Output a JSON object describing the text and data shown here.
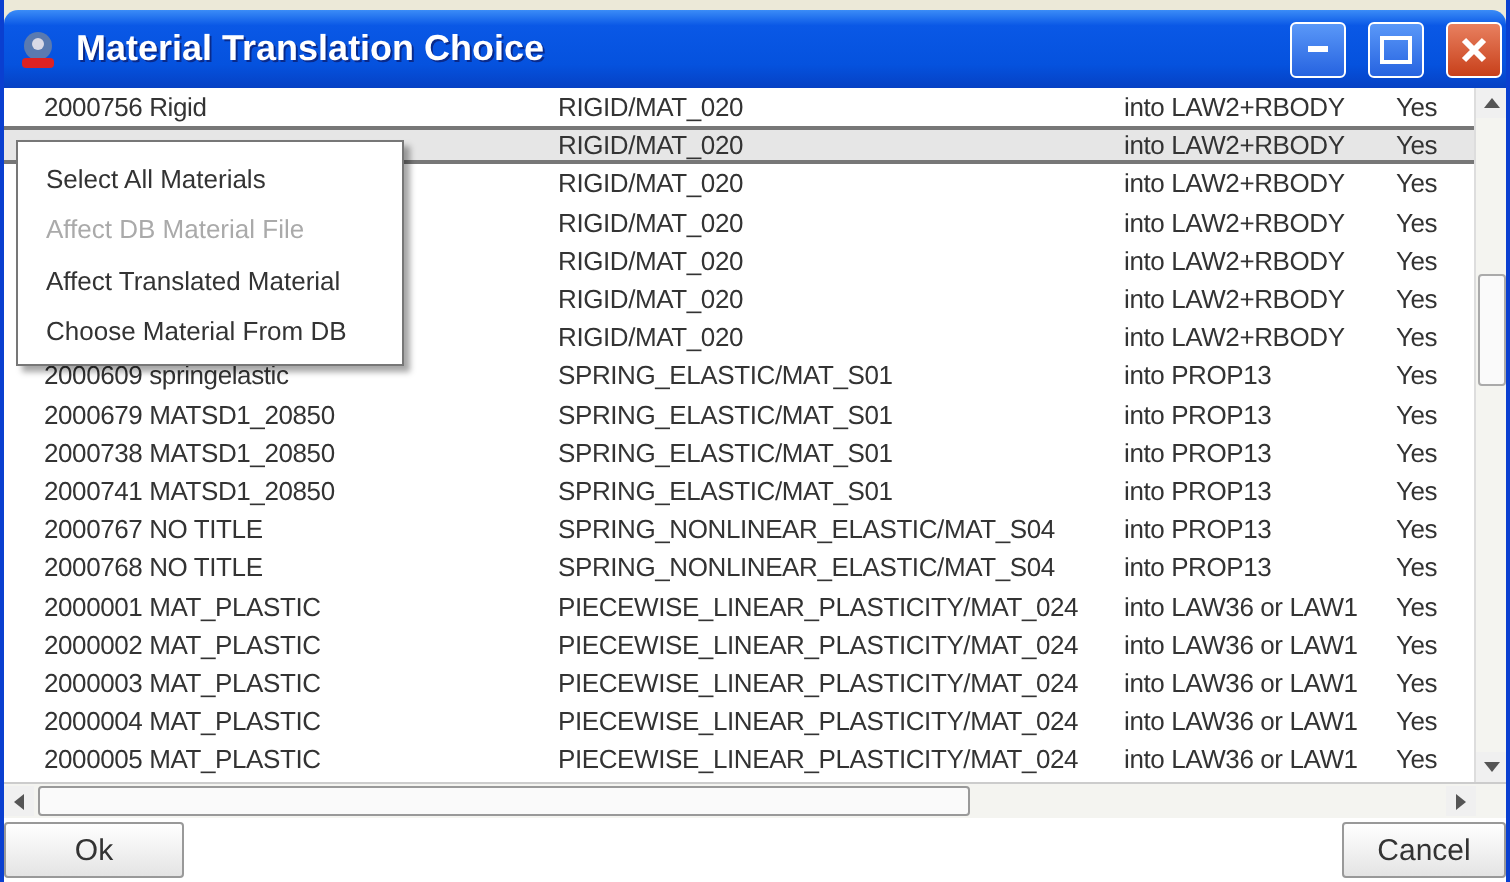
{
  "window": {
    "title": "Material Translation Choice"
  },
  "table": {
    "rows": [
      {
        "column_1": "2000756  Rigid",
        "column_2": "RIGID/MAT_020",
        "column_3": "into LAW2+RBODY",
        "column_4": "Yes",
        "selected": false
      },
      {
        "column_2": "RIGID/MAT_020",
        "column_3": "into LAW2+RBODY",
        "column_4": "Yes",
        "selected": true
      },
      {
        "column_2": "RIGID/MAT_020",
        "column_3": "into LAW2+RBODY",
        "column_4": "Yes",
        "selected": false
      },
      {
        "column_2": "RIGID/MAT_020",
        "column_3": "into LAW2+RBODY",
        "column_4": "Yes",
        "selected": false
      },
      {
        "column_2": "RIGID/MAT_020",
        "column_3": "into LAW2+RBODY",
        "column_4": "Yes",
        "selected": false
      },
      {
        "column_2": "RIGID/MAT_020",
        "column_3": "into LAW2+RBODY",
        "column_4": "Yes",
        "selected": false
      },
      {
        "column_2": "RIGID/MAT_020",
        "column_3": "into LAW2+RBODY",
        "column_4": "Yes",
        "selected": false
      },
      {
        "column_1": "2000609  springelastic",
        "column_2": "SPRING_ELASTIC/MAT_S01",
        "column_3": "into PROP13",
        "column_4": "Yes",
        "selected": false
      },
      {
        "column_1": "2000679  MATSD1_20850",
        "column_2": "SPRING_ELASTIC/MAT_S01",
        "column_3": "into PROP13",
        "column_4": "Yes",
        "selected": false
      },
      {
        "column_1": "2000738  MATSD1_20850",
        "column_2": "SPRING_ELASTIC/MAT_S01",
        "column_3": "into PROP13",
        "column_4": "Yes",
        "selected": false
      },
      {
        "column_1": "2000741  MATSD1_20850",
        "column_2": "SPRING_ELASTIC/MAT_S01",
        "column_3": "into PROP13",
        "column_4": "Yes",
        "selected": false
      },
      {
        "column_1": "2000767  NO TITLE",
        "column_2": "SPRING_NONLINEAR_ELASTIC/MAT_S04",
        "column_3": "into PROP13",
        "column_4": "Yes",
        "selected": false
      },
      {
        "column_1": "2000768  NO TITLE",
        "column_2": "SPRING_NONLINEAR_ELASTIC/MAT_S04",
        "column_3": "into PROP13",
        "column_4": "Yes",
        "selected": false
      },
      {
        "column_1": "2000001  MAT_PLASTIC",
        "column_2": "PIECEWISE_LINEAR_PLASTICITY/MAT_024",
        "column_3": "into LAW36 or LAW1",
        "column_4": "Yes",
        "selected": false
      },
      {
        "column_1": "2000002  MAT_PLASTIC",
        "column_2": "PIECEWISE_LINEAR_PLASTICITY/MAT_024",
        "column_3": "into LAW36 or LAW1",
        "column_4": "Yes",
        "selected": false
      },
      {
        "column_1": "2000003  MAT_PLASTIC",
        "column_2": "PIECEWISE_LINEAR_PLASTICITY/MAT_024",
        "column_3": "into LAW36 or LAW1",
        "column_4": "Yes",
        "selected": false
      },
      {
        "column_1": "2000004  MAT_PLASTIC",
        "column_2": "PIECEWISE_LINEAR_PLASTICITY/MAT_024",
        "column_3": "into LAW36 or LAW1",
        "column_4": "Yes",
        "selected": false
      },
      {
        "column_1": "2000005  MAT_PLASTIC",
        "column_2": "PIECEWISE_LINEAR_PLASTICITY/MAT_024",
        "column_3": "into LAW36 or LAW1",
        "column_4": "Yes",
        "selected": false
      }
    ]
  },
  "context_menu": {
    "items": [
      {
        "label": "Select All Materials",
        "disabled": false
      },
      {
        "label": "Affect DB Material File",
        "disabled": true
      },
      {
        "label": "Affect Translated Material",
        "disabled": false
      },
      {
        "label": "Choose Material From DB",
        "disabled": false
      }
    ]
  },
  "buttons": [
    "Ok",
    "Cancel"
  ]
}
